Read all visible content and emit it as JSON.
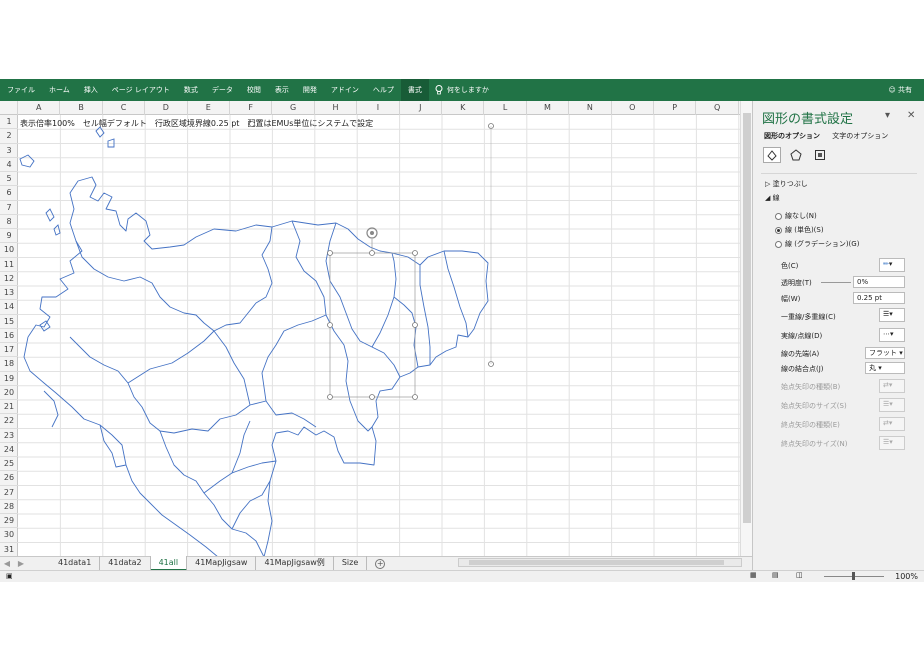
{
  "ribbon": {
    "tabs": [
      "ファイル",
      "ホーム",
      "挿入",
      "ページ レイアウト",
      "数式",
      "データ",
      "校閲",
      "表示",
      "開発",
      "アドイン",
      "ヘルプ",
      "書式"
    ],
    "active_tab": "書式",
    "tell_me": "何をしますか",
    "share": "共有"
  },
  "sheet": {
    "columns": [
      "A",
      "B",
      "C",
      "D",
      "E",
      "F",
      "G",
      "H",
      "I",
      "J",
      "K",
      "L",
      "M",
      "N",
      "O",
      "P",
      "Q"
    ],
    "rows": [
      "1",
      "2",
      "3",
      "4",
      "5",
      "6",
      "7",
      "8",
      "9",
      "10",
      "11",
      "12",
      "13",
      "14",
      "15",
      "16",
      "17",
      "18",
      "19",
      "20",
      "21",
      "22",
      "23",
      "24",
      "25",
      "26",
      "27",
      "28",
      "29",
      "30",
      "31"
    ],
    "a1_text": "表示倍率100%　セル幅デフォルト　行政区域境界線0.25 pt　配置はEMUs単位にシステムで設定"
  },
  "sheet_tabs": [
    "41data1",
    "41data2",
    "41all",
    "41MapJigsaw",
    "41MapJigsaw例",
    "Size"
  ],
  "active_sheet": "41all",
  "status": {
    "zoom": "100%"
  },
  "panel": {
    "title": "図形の書式設定",
    "subtabs": [
      "図形のオプション",
      "文字のオプション"
    ],
    "fill_section": "塗りつぶし",
    "line_section": "線",
    "radios": [
      "線なし(N)",
      "線 (単色)(S)",
      "線 (グラデーション)(G)"
    ],
    "selected_radio": 1,
    "props": {
      "color": "色(C)",
      "transparency": "透明度(T)",
      "transparency_val": "0%",
      "width": "幅(W)",
      "width_val": "0.25 pt",
      "compound": "一重線/多重線(C)",
      "dash": "実線/点線(D)",
      "cap": "線の先端(A)",
      "cap_val": "フラット",
      "join": "線の結合点(J)",
      "join_val": "丸",
      "begin_arrow_type": "始点矢印の種類(B)",
      "begin_arrow_size": "始点矢印のサイズ(S)",
      "end_arrow_type": "終点矢印の種類(E)",
      "end_arrow_size": "終点矢印のサイズ(N)"
    }
  },
  "colors": {
    "accent": "#217346",
    "map_line": "#4472c4"
  },
  "icons": [
    "lightbulb-icon",
    "person-icon",
    "fill-line-icon",
    "pentagon-effects-icon",
    "size-properties-icon",
    "close-icon",
    "pin-icon",
    "rotate-handle-icon"
  ]
}
